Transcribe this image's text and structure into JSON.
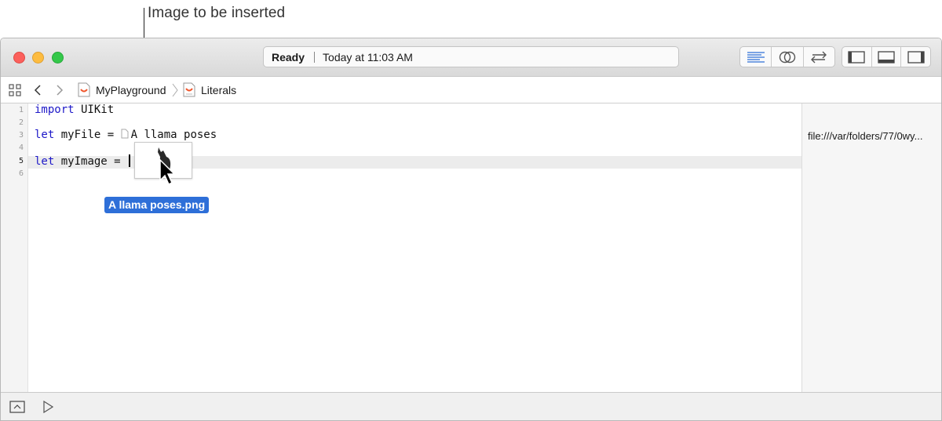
{
  "annotation": {
    "label": "Image to be inserted"
  },
  "toolbar": {
    "status_state": "Ready",
    "status_time": "Today at 11:03 AM",
    "editor_buttons": [
      "standard-editor-icon",
      "assistant-editor-icon",
      "version-editor-icon"
    ],
    "view_buttons": [
      "navigator-toggle-icon",
      "debug-area-toggle-icon",
      "utilities-toggle-icon"
    ]
  },
  "breadcrumb": {
    "project": "MyPlayground",
    "page": "Literals"
  },
  "editor": {
    "line_numbers": [
      "1",
      "2",
      "3",
      "4",
      "5",
      "6"
    ],
    "active_line": "5",
    "line1": {
      "keyword": "import",
      "rest": " UIKit"
    },
    "line3": {
      "keyword": "let",
      "rest": " myFile = ",
      "file_literal": "A llama poses"
    },
    "line5": {
      "keyword": "let",
      "rest": " myImage = "
    }
  },
  "results": {
    "line3": "file:///var/folders/77/0wy..."
  },
  "drag": {
    "filename": "A llama poses.png"
  },
  "colors": {
    "keyword": "#1d18c8",
    "selection": "#2e6fd8",
    "close": "#fc605c",
    "minimize": "#fdbc40",
    "maximize": "#34c84a"
  }
}
